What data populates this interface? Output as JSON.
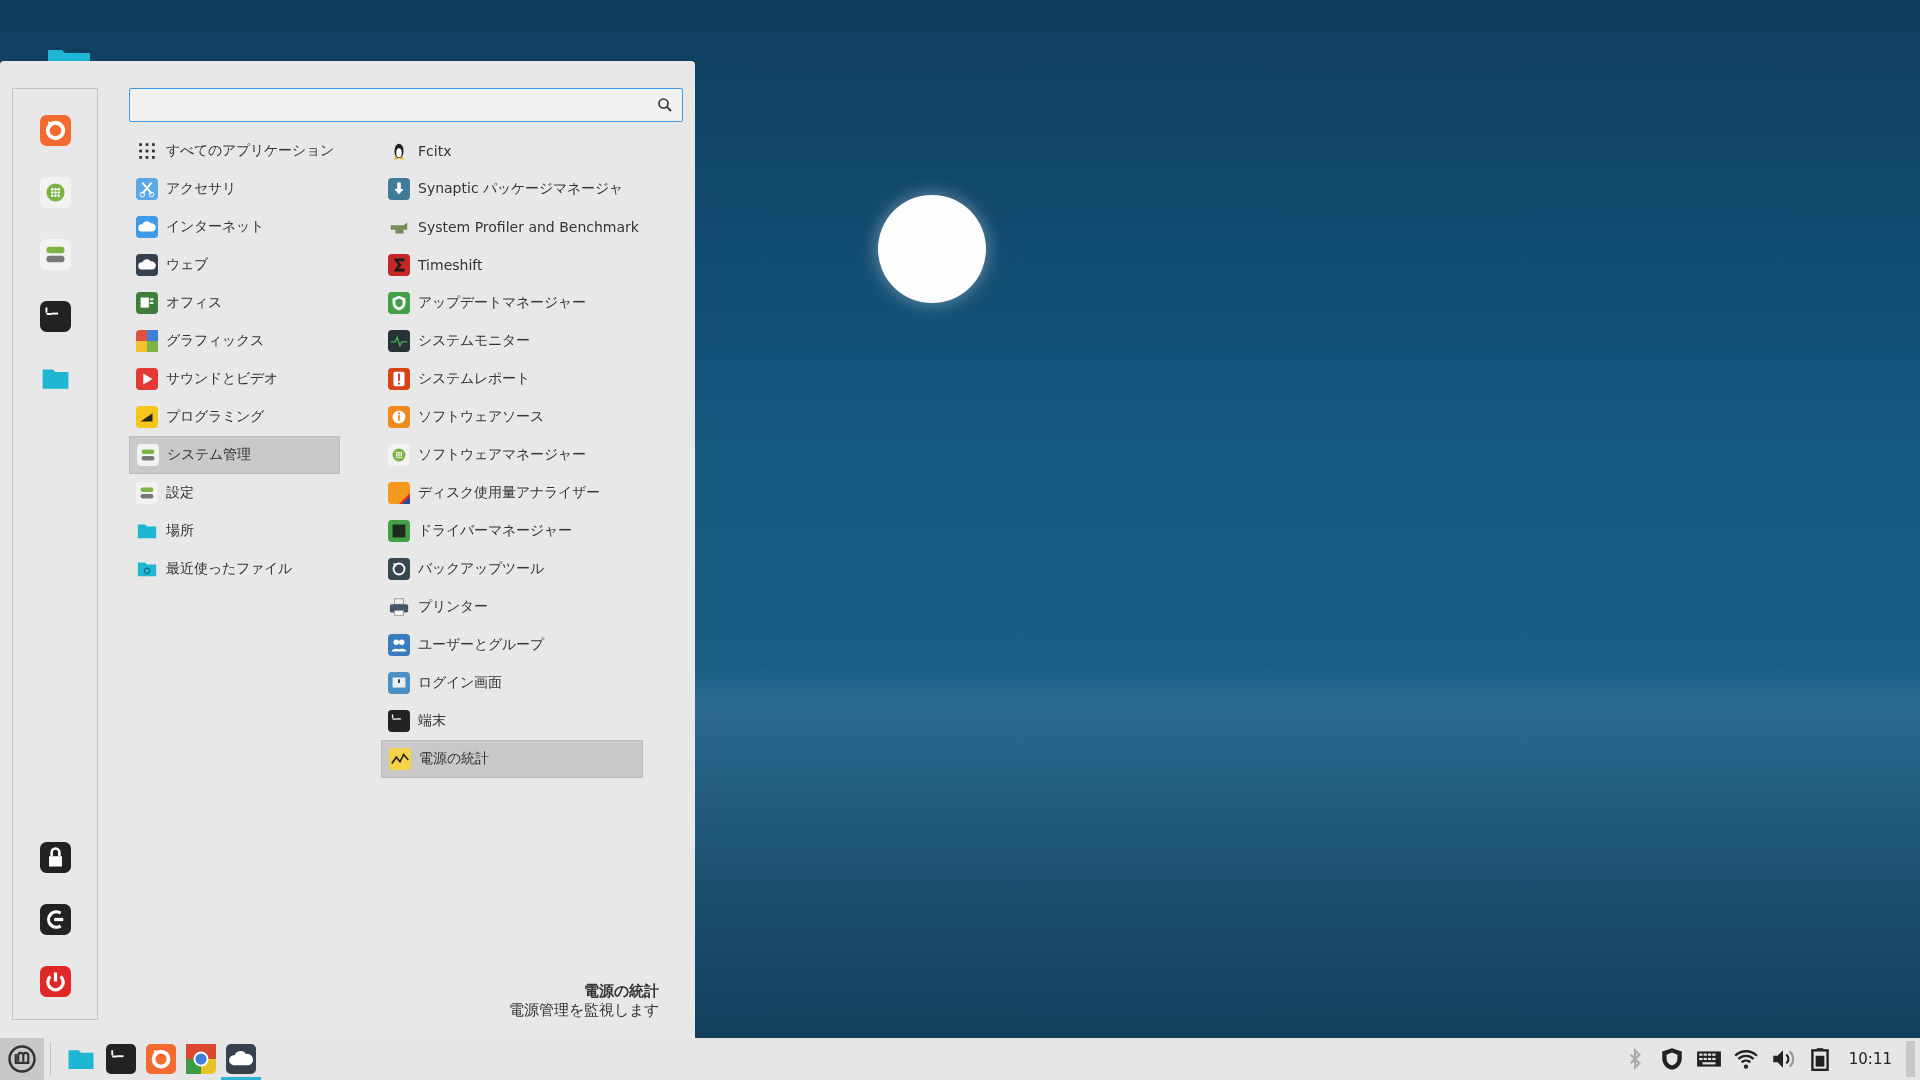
{
  "categories": [
    {
      "label": "すべてのアプリケーション",
      "kind": "grid",
      "selected": false
    },
    {
      "label": "アクセサリ",
      "kind": "scissors",
      "selected": false
    },
    {
      "label": "インターネット",
      "kind": "cloud",
      "selected": false
    },
    {
      "label": "ウェブ",
      "kind": "cloud-dark",
      "selected": false
    },
    {
      "label": "オフィス",
      "kind": "document",
      "selected": false
    },
    {
      "label": "グラフィックス",
      "kind": "palette",
      "selected": false
    },
    {
      "label": "サウンドとビデオ",
      "kind": "play",
      "selected": false
    },
    {
      "label": "プログラミング",
      "kind": "ruler",
      "selected": false
    },
    {
      "label": "システム管理",
      "kind": "toggles",
      "selected": true
    },
    {
      "label": "設定",
      "kind": "toggles",
      "selected": false
    },
    {
      "label": "場所",
      "kind": "folder",
      "selected": false
    },
    {
      "label": "最近使ったファイル",
      "kind": "clock-folder",
      "selected": false
    }
  ],
  "applications": [
    {
      "label": "Fcitx",
      "kind": "penguin",
      "selected": false
    },
    {
      "label": "Synaptic パッケージマネージャ",
      "kind": "download",
      "selected": false
    },
    {
      "label": "System Profiler and Benchmark",
      "kind": "gauge",
      "selected": false
    },
    {
      "label": "Timeshift",
      "kind": "sigma",
      "selected": false
    },
    {
      "label": "アップデートマネージャー",
      "kind": "shield",
      "selected": false
    },
    {
      "label": "システムモニター",
      "kind": "pulse",
      "selected": false
    },
    {
      "label": "システムレポート",
      "kind": "exclamation",
      "selected": false
    },
    {
      "label": "ソフトウェアソース",
      "kind": "info",
      "selected": false
    },
    {
      "label": "ソフトウェアマネージャー",
      "kind": "dots",
      "selected": false
    },
    {
      "label": "ディスク使用量アナライザー",
      "kind": "pie",
      "selected": false
    },
    {
      "label": "ドライバーマネージャー",
      "kind": "chip",
      "selected": false
    },
    {
      "label": "バックアップツール",
      "kind": "refresh",
      "selected": false
    },
    {
      "label": "プリンター",
      "kind": "printer",
      "selected": false
    },
    {
      "label": "ユーザーとグループ",
      "kind": "people",
      "selected": false
    },
    {
      "label": "ログイン画面",
      "kind": "screen",
      "selected": false
    },
    {
      "label": "端末",
      "kind": "terminal",
      "selected": false
    },
    {
      "label": "電源の統計",
      "kind": "chart",
      "selected": true
    }
  ],
  "description": {
    "title": "電源の統計",
    "text": "電源管理を監視します"
  },
  "taskbar": {
    "launchers": [
      {
        "kind": "folder",
        "active": false
      },
      {
        "kind": "terminal",
        "active": false
      },
      {
        "kind": "swirl",
        "active": false
      },
      {
        "kind": "globe",
        "active": false
      },
      {
        "kind": "cloud-dark",
        "active": true
      }
    ],
    "tray": [
      {
        "kind": "bluetooth",
        "disabled": true
      },
      {
        "kind": "shield",
        "disabled": false
      },
      {
        "kind": "keyboard",
        "disabled": false
      },
      {
        "kind": "wifi",
        "disabled": false
      },
      {
        "kind": "volume",
        "disabled": false
      },
      {
        "kind": "battery",
        "disabled": false
      }
    ],
    "clock": "10:11"
  }
}
